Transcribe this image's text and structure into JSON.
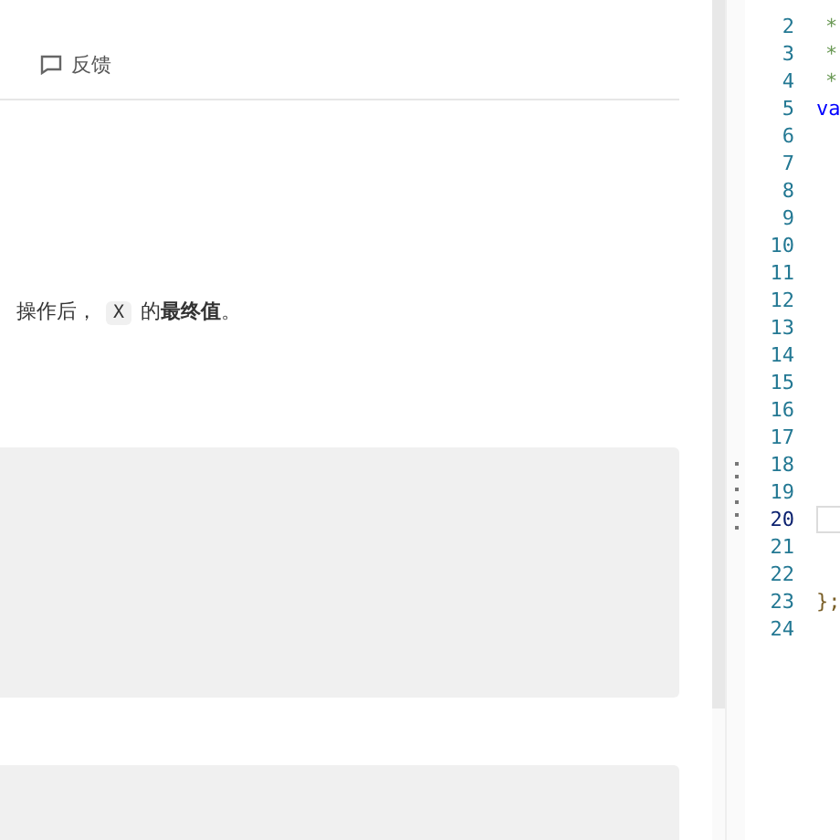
{
  "header": {
    "feedback_label": "反馈"
  },
  "statement": [
    {
      "kind": "text",
      "text": "操作后，"
    },
    {
      "kind": "code",
      "text": "X"
    },
    {
      "kind": "text",
      "text": "的"
    },
    {
      "kind": "bold",
      "text": "最终值"
    },
    {
      "kind": "text",
      "text": "。"
    }
  ],
  "examples": [
    {
      "kind": "block"
    },
    {
      "kind": "block"
    }
  ],
  "editor": {
    "lines": [
      {
        "number": "2",
        "code": "*",
        "kind": "comment",
        "active": false
      },
      {
        "number": "3",
        "code": "*",
        "kind": "comment",
        "active": false
      },
      {
        "number": "4",
        "code": "*",
        "kind": "comment",
        "active": false
      },
      {
        "number": "5",
        "code": "va",
        "kind": "keyword",
        "active": false
      },
      {
        "number": "6",
        "active": false
      },
      {
        "number": "7",
        "active": false
      },
      {
        "number": "8",
        "active": false
      },
      {
        "number": "9",
        "active": false
      },
      {
        "number": "10",
        "active": false
      },
      {
        "number": "11",
        "active": false
      },
      {
        "number": "12",
        "active": false
      },
      {
        "number": "13",
        "active": false
      },
      {
        "number": "14",
        "active": false
      },
      {
        "number": "15",
        "active": false
      },
      {
        "number": "16",
        "active": false
      },
      {
        "number": "17",
        "active": false
      },
      {
        "number": "18",
        "active": false
      },
      {
        "number": "19",
        "active": false
      },
      {
        "number": "20",
        "active": true
      },
      {
        "number": "21",
        "active": false
      },
      {
        "number": "22",
        "active": false
      },
      {
        "number": "23",
        "code": "};",
        "kind": "bracket",
        "active": false
      },
      {
        "number": "24",
        "active": false
      }
    ]
  }
}
